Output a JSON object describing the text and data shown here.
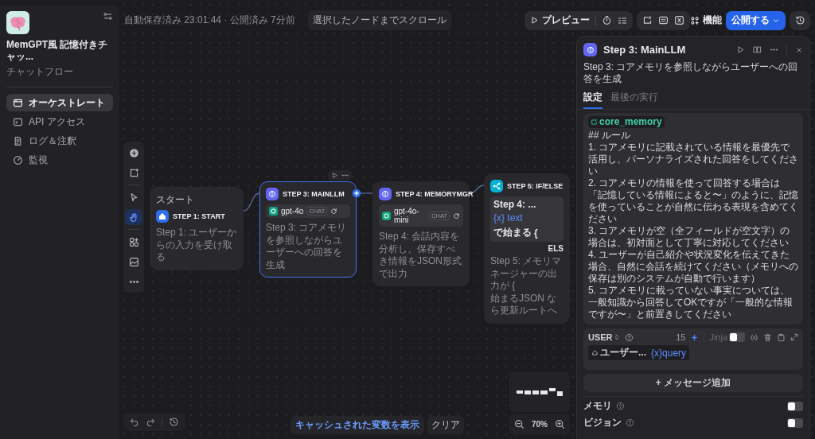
{
  "app": {
    "name": "MemGPT風 記憶付きチャッ...",
    "type": "チャットフロー"
  },
  "nav": [
    {
      "label": "オーケストレート",
      "selected": true
    },
    {
      "label": "API アクセス",
      "selected": false
    },
    {
      "label": "ログ＆注釈",
      "selected": false
    },
    {
      "label": "監視",
      "selected": false
    }
  ],
  "status": "自動保存済み 23:01:44 · 公開済み 7分前",
  "scroll_button": "選択したノードまでスクロール",
  "toolbar": {
    "preview": "プレビュー",
    "features": "機能",
    "publish": "公開する"
  },
  "tools": [
    {
      "selected": false
    },
    {
      "selected": false
    },
    {
      "selected": false
    },
    {
      "selected": true
    },
    {
      "selected": false
    },
    {
      "selected": false
    },
    {
      "selected": false
    }
  ],
  "nodes": [
    {
      "kind": "start",
      "tag": "スタート",
      "title": "STEP 1: START",
      "selected": false,
      "description": "Step 1: ユーザーからの入力を受け取る"
    },
    {
      "kind": "llm",
      "title": "STEP 3: MAINLLM",
      "selected": true,
      "model": "gpt-4o",
      "mode": "CHAT",
      "description": "Step 3: コアメモリを参照しながらユーザーへの回答を生成"
    },
    {
      "kind": "llm",
      "title": "STEP 4: MEMORYMGR",
      "selected": false,
      "model": "gpt-4o-mini",
      "mode": "CHAT",
      "description": "Step 4: 会話内容を分析し、保存すべき情報をJSON形式で出力"
    },
    {
      "kind": "ifelse",
      "title": "STEP 5: IF/ELSE",
      "selected": false,
      "condition": {
        "source": "Step 4: ...",
        "variable": "{x} text",
        "operator": "で始まる",
        "value": "{"
      },
      "branch": "ELS",
      "description_lines": [
        "Step 5: メモリマネージャーの出力が {",
        "始まるJSON なら更新ルートへ"
      ]
    }
  ],
  "panel": {
    "title": "Step 3: MainLLM",
    "description": "Step 3: コアメモリを参照しながらユーザーへの回答を生成",
    "tabs": [
      {
        "label": "設定",
        "selected": true
      },
      {
        "label": "最後の実行",
        "selected": false
      }
    ],
    "prompt": {
      "variable": "core_memory",
      "heading": "## ルール",
      "rules": [
        "1. コアメモリに記載されている情報を最優先で活用し、パーソナライズされた回答をしてください",
        "2. コアメモリの情報を使って回答する場合は「記憶している情報によると〜」のように、記憶を使っていることが自然に伝わる表現を含めてください",
        "3. コアメモリが空（全フィールドが空文字）の場合は、初対面として丁寧に対応してください",
        "4. ユーザーが自己紹介や状況変化を伝えてきた場合、自然に会話を続けてください（メモリへの保存は別のシステムが自動で行います）",
        "5. コアメモリに載っていない事実については、一般知識から回答してOKですが「一般的な情報ですが〜」と前置きしてください"
      ]
    },
    "message": {
      "role": "USER",
      "count": "15",
      "jinja": {
        "label": "Jinja",
        "on": false
      },
      "source": "ユーザー...",
      "variable": "{x}query"
    },
    "add_message": "+ メッセージ追加",
    "settings": [
      {
        "label": "メモリ",
        "on": false
      },
      {
        "label": "ビジョン",
        "on": false
      }
    ]
  },
  "footer": {
    "cache_button": "キャッシュされた変数を表示",
    "clear_button": "クリア",
    "zoom": "70%"
  }
}
